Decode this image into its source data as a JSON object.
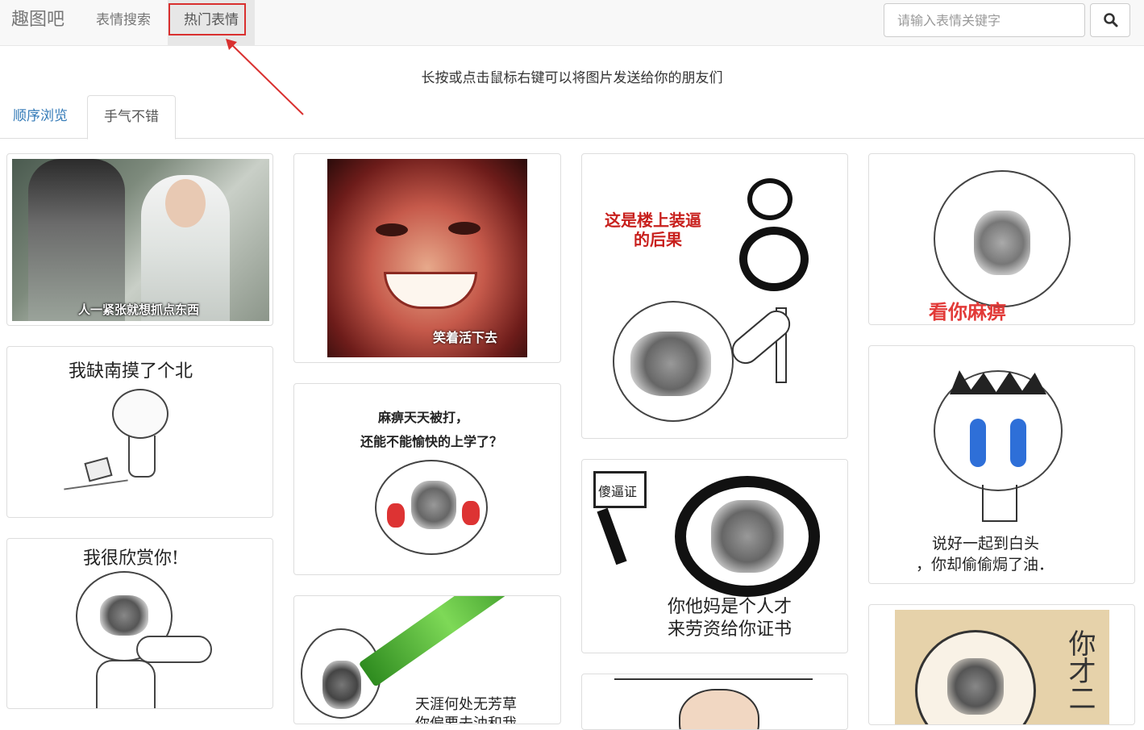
{
  "navbar": {
    "brand": "趣图吧",
    "links": [
      {
        "label": "表情搜索"
      },
      {
        "label": "热门表情"
      }
    ],
    "search": {
      "placeholder": "请输入表情关键字"
    }
  },
  "hint": "长按或点击鼠标右键可以将图片发送给你的朋友们",
  "tabs": [
    {
      "label": "顺序浏览"
    },
    {
      "label": "手气不错"
    }
  ],
  "cards": [
    {
      "caption": "人一紧张就想抓点东西"
    },
    {
      "caption": "我缺南摸了个北"
    },
    {
      "caption": "我很欣赏你!"
    },
    {
      "caption": "笑着活下去"
    },
    {
      "caption": "麻痹天天被打，",
      "caption2": "还能不能愉快的上学了？"
    },
    {
      "caption": "天涯何处无芳草",
      "caption2": "你偏要去油和我"
    },
    {
      "caption": "这是楼上装逼",
      "caption2": "的后果"
    },
    {
      "caption": "傻逼证",
      "caption2": "你他妈是个人才",
      "caption3": "来劳资给你证书"
    },
    {
      "caption": "看你麻痹"
    },
    {
      "caption": "说好一起到白头",
      "caption2": "，你却偷偷焗了油．"
    },
    {
      "caption": "你才二"
    }
  ],
  "colors": {
    "accent_red": "#d9302f",
    "link_blue": "#337ab7"
  }
}
